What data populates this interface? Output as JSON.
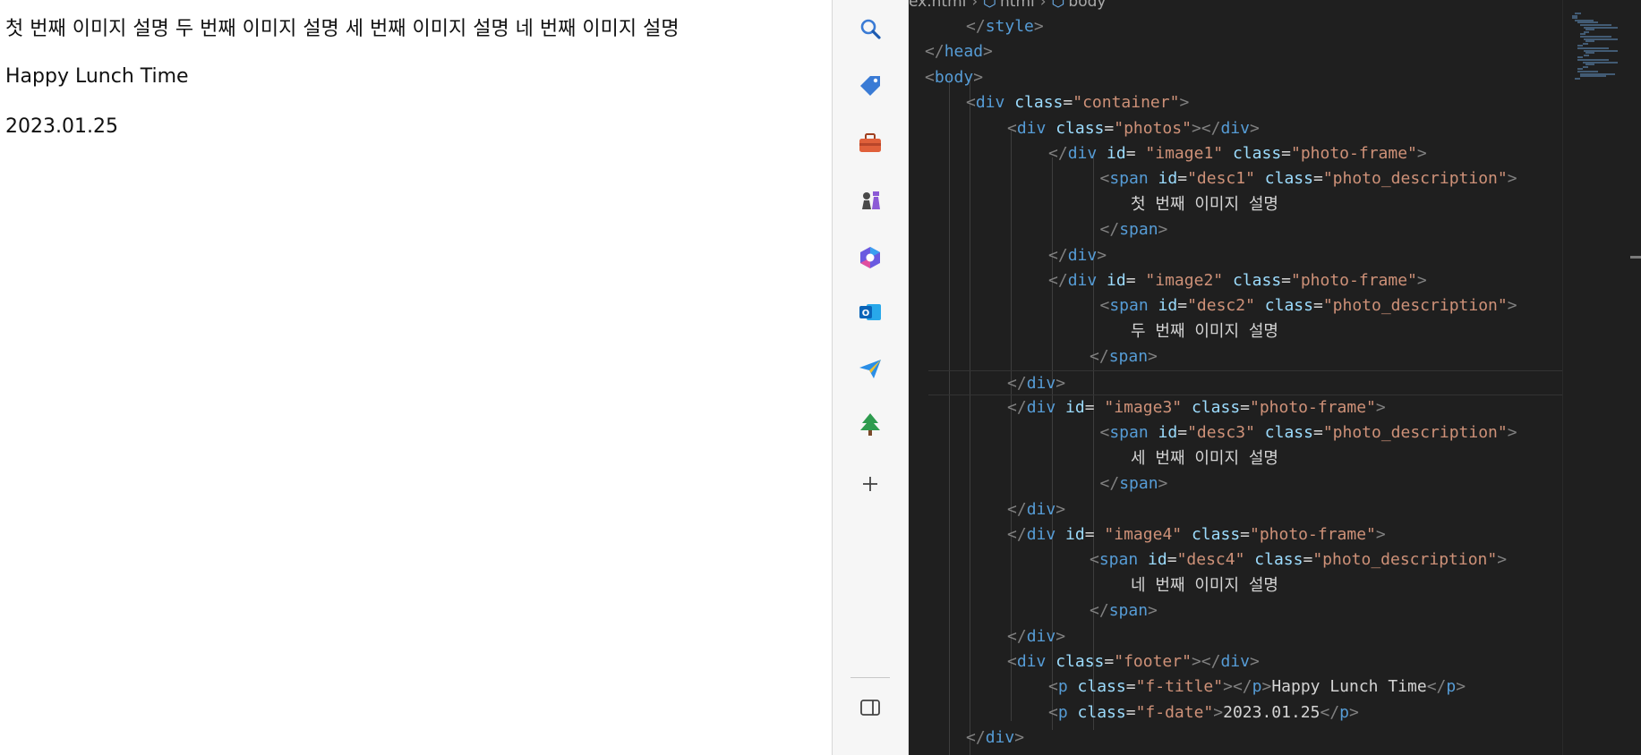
{
  "preview": {
    "descriptions": "첫 번째 이미지 설명 두 번째 이미지 설명 세 번째 이미지 설명 네 번째 이미지 설명",
    "footer_title": "Happy Lunch Time",
    "footer_date": "2023.01.25"
  },
  "sidebar": {
    "items": [
      {
        "name": "search",
        "icon": "search-icon"
      },
      {
        "name": "shopping",
        "icon": "tag-icon"
      },
      {
        "name": "tools",
        "icon": "briefcase-icon"
      },
      {
        "name": "games",
        "icon": "chess-icon"
      },
      {
        "name": "copilot",
        "icon": "copilot-icon"
      },
      {
        "name": "outlook",
        "icon": "outlook-icon"
      },
      {
        "name": "send",
        "icon": "paper-plane-icon"
      },
      {
        "name": "tree",
        "icon": "tree-icon"
      },
      {
        "name": "add",
        "icon": "plus-icon"
      },
      {
        "name": "split-screen",
        "icon": "split-screen-icon"
      }
    ],
    "colors": {
      "blue": "#3a7bd5",
      "orange": "#e0603a",
      "green": "#2e9b4e"
    }
  },
  "editor": {
    "breadcrumb": [
      "ex.html",
      "html",
      "body"
    ],
    "lines": [
      {
        "indent": 1,
        "tokens": [
          [
            "punc",
            "</"
          ],
          [
            "tag",
            "style"
          ],
          [
            "punc",
            ">"
          ]
        ]
      },
      {
        "indent": 0,
        "tokens": [
          [
            "punc",
            "</"
          ],
          [
            "tag",
            "head"
          ],
          [
            "punc",
            ">"
          ]
        ]
      },
      {
        "indent": 0,
        "tokens": [
          [
            "punc",
            "<"
          ],
          [
            "tag",
            "body"
          ],
          [
            "punc",
            ">"
          ]
        ]
      },
      {
        "indent": 1,
        "tokens": [
          [
            "punc",
            "<"
          ],
          [
            "tag",
            "div"
          ],
          [
            "txt",
            " "
          ],
          [
            "attr",
            "class"
          ],
          [
            "txt",
            "="
          ],
          [
            "str",
            "\"container\""
          ],
          [
            "punc",
            ">"
          ]
        ]
      },
      {
        "indent": 2,
        "tokens": [
          [
            "punc",
            "<"
          ],
          [
            "tag",
            "div"
          ],
          [
            "txt",
            " "
          ],
          [
            "attr",
            "class"
          ],
          [
            "txt",
            "="
          ],
          [
            "str",
            "\"photos\""
          ],
          [
            "punc",
            "></"
          ],
          [
            "tag",
            "div"
          ],
          [
            "punc",
            ">"
          ]
        ]
      },
      {
        "indent": 3,
        "tokens": [
          [
            "punc",
            "</"
          ],
          [
            "tag",
            "div"
          ],
          [
            "txt",
            " "
          ],
          [
            "attr",
            "id"
          ],
          [
            "txt",
            "= "
          ],
          [
            "str",
            "\"image1\""
          ],
          [
            "txt",
            " "
          ],
          [
            "attr",
            "class"
          ],
          [
            "txt",
            "="
          ],
          [
            "str",
            "\"photo-frame\""
          ],
          [
            "punc",
            ">"
          ]
        ]
      },
      {
        "indent": 4.25,
        "tokens": [
          [
            "punc",
            "<"
          ],
          [
            "tag",
            "span"
          ],
          [
            "txt",
            " "
          ],
          [
            "attr",
            "id"
          ],
          [
            "txt",
            "="
          ],
          [
            "str",
            "\"desc1\""
          ],
          [
            "txt",
            " "
          ],
          [
            "attr",
            "class"
          ],
          [
            "txt",
            "="
          ],
          [
            "str",
            "\"photo_description\""
          ],
          [
            "punc",
            ">"
          ]
        ]
      },
      {
        "indent": 5,
        "tokens": [
          [
            "txt",
            "첫 번째 이미지 설명"
          ]
        ]
      },
      {
        "indent": 4.25,
        "tokens": [
          [
            "punc",
            "</"
          ],
          [
            "tag",
            "span"
          ],
          [
            "punc",
            ">"
          ]
        ]
      },
      {
        "indent": 3,
        "tokens": [
          [
            "punc",
            "</"
          ],
          [
            "tag",
            "div"
          ],
          [
            "punc",
            ">"
          ]
        ]
      },
      {
        "indent": 3,
        "tokens": [
          [
            "punc",
            "</"
          ],
          [
            "tag",
            "div"
          ],
          [
            "txt",
            " "
          ],
          [
            "attr",
            "id"
          ],
          [
            "txt",
            "= "
          ],
          [
            "str",
            "\"image2\""
          ],
          [
            "txt",
            " "
          ],
          [
            "attr",
            "class"
          ],
          [
            "txt",
            "="
          ],
          [
            "str",
            "\"photo-frame\""
          ],
          [
            "punc",
            ">"
          ]
        ]
      },
      {
        "indent": 4.25,
        "tokens": [
          [
            "punc",
            "<"
          ],
          [
            "tag",
            "span"
          ],
          [
            "txt",
            " "
          ],
          [
            "attr",
            "id"
          ],
          [
            "txt",
            "="
          ],
          [
            "str",
            "\"desc2\""
          ],
          [
            "txt",
            " "
          ],
          [
            "attr",
            "class"
          ],
          [
            "txt",
            "="
          ],
          [
            "str",
            "\"photo_description\""
          ],
          [
            "punc",
            ">"
          ]
        ]
      },
      {
        "indent": 5,
        "tokens": [
          [
            "txt",
            "두 번째 이미지 설명"
          ]
        ]
      },
      {
        "indent": 4,
        "tokens": [
          [
            "punc",
            "</"
          ],
          [
            "tag",
            "span"
          ],
          [
            "punc",
            ">"
          ]
        ]
      },
      {
        "indent": 2,
        "tokens": [
          [
            "punc",
            "</"
          ],
          [
            "tag",
            "div"
          ],
          [
            "punc",
            ">"
          ]
        ],
        "current": true
      },
      {
        "indent": 2,
        "tokens": [
          [
            "punc",
            "</"
          ],
          [
            "tag",
            "div"
          ],
          [
            "txt",
            " "
          ],
          [
            "attr",
            "id"
          ],
          [
            "txt",
            "= "
          ],
          [
            "str",
            "\"image3\""
          ],
          [
            "txt",
            " "
          ],
          [
            "attr",
            "class"
          ],
          [
            "txt",
            "="
          ],
          [
            "str",
            "\"photo-frame\""
          ],
          [
            "punc",
            ">"
          ]
        ]
      },
      {
        "indent": 4.25,
        "tokens": [
          [
            "punc",
            "<"
          ],
          [
            "tag",
            "span"
          ],
          [
            "txt",
            " "
          ],
          [
            "attr",
            "id"
          ],
          [
            "txt",
            "="
          ],
          [
            "str",
            "\"desc3\""
          ],
          [
            "txt",
            " "
          ],
          [
            "attr",
            "class"
          ],
          [
            "txt",
            "="
          ],
          [
            "str",
            "\"photo_description\""
          ],
          [
            "punc",
            ">"
          ]
        ]
      },
      {
        "indent": 5,
        "tokens": [
          [
            "txt",
            "세 번째 이미지 설명"
          ]
        ]
      },
      {
        "indent": 4.25,
        "tokens": [
          [
            "punc",
            "</"
          ],
          [
            "tag",
            "span"
          ],
          [
            "punc",
            ">"
          ]
        ]
      },
      {
        "indent": 2,
        "tokens": [
          [
            "punc",
            "</"
          ],
          [
            "tag",
            "div"
          ],
          [
            "punc",
            ">"
          ]
        ]
      },
      {
        "indent": 2,
        "tokens": [
          [
            "punc",
            "</"
          ],
          [
            "tag",
            "div"
          ],
          [
            "txt",
            " "
          ],
          [
            "attr",
            "id"
          ],
          [
            "txt",
            "= "
          ],
          [
            "str",
            "\"image4\""
          ],
          [
            "txt",
            " "
          ],
          [
            "attr",
            "class"
          ],
          [
            "txt",
            "="
          ],
          [
            "str",
            "\"photo-frame\""
          ],
          [
            "punc",
            ">"
          ]
        ]
      },
      {
        "indent": 4,
        "tokens": [
          [
            "punc",
            "<"
          ],
          [
            "tag",
            "span"
          ],
          [
            "txt",
            " "
          ],
          [
            "attr",
            "id"
          ],
          [
            "txt",
            "="
          ],
          [
            "str",
            "\"desc4\""
          ],
          [
            "txt",
            " "
          ],
          [
            "attr",
            "class"
          ],
          [
            "txt",
            "="
          ],
          [
            "str",
            "\"photo_description\""
          ],
          [
            "punc",
            ">"
          ]
        ]
      },
      {
        "indent": 5,
        "tokens": [
          [
            "txt",
            "네 번째 이미지 설명"
          ]
        ]
      },
      {
        "indent": 4,
        "tokens": [
          [
            "punc",
            "</"
          ],
          [
            "tag",
            "span"
          ],
          [
            "punc",
            ">"
          ]
        ]
      },
      {
        "indent": 2,
        "tokens": [
          [
            "punc",
            "</"
          ],
          [
            "tag",
            "div"
          ],
          [
            "punc",
            ">"
          ]
        ]
      },
      {
        "indent": 2,
        "tokens": [
          [
            "punc",
            "<"
          ],
          [
            "tag",
            "div"
          ],
          [
            "txt",
            " "
          ],
          [
            "attr",
            "class"
          ],
          [
            "txt",
            "="
          ],
          [
            "str",
            "\"footer\""
          ],
          [
            "punc",
            "></"
          ],
          [
            "tag",
            "div"
          ],
          [
            "punc",
            ">"
          ]
        ]
      },
      {
        "indent": 3,
        "tokens": [
          [
            "punc",
            "<"
          ],
          [
            "tag",
            "p"
          ],
          [
            "txt",
            " "
          ],
          [
            "attr",
            "class"
          ],
          [
            "txt",
            "="
          ],
          [
            "str",
            "\"f-title\""
          ],
          [
            "punc",
            "></"
          ],
          [
            "tag",
            "p"
          ],
          [
            "punc",
            ">"
          ],
          [
            "txt",
            "Happy Lunch Time"
          ],
          [
            "punc",
            "</"
          ],
          [
            "tag",
            "p"
          ],
          [
            "punc",
            ">"
          ]
        ]
      },
      {
        "indent": 3,
        "tokens": [
          [
            "punc",
            "<"
          ],
          [
            "tag",
            "p"
          ],
          [
            "txt",
            " "
          ],
          [
            "attr",
            "class"
          ],
          [
            "txt",
            "="
          ],
          [
            "str",
            "\"f-date\""
          ],
          [
            "punc",
            ">"
          ],
          [
            "txt",
            "2023.01.25"
          ],
          [
            "punc",
            "</"
          ],
          [
            "tag",
            "p"
          ],
          [
            "punc",
            ">"
          ]
        ]
      },
      {
        "indent": 1,
        "tokens": [
          [
            "punc",
            "</"
          ],
          [
            "tag",
            "div"
          ],
          [
            "punc",
            ">"
          ]
        ]
      }
    ],
    "colors": {
      "bg": "#1f1f1f",
      "tag": "#569cd6",
      "attr": "#9cdcfe",
      "string": "#ce9178",
      "punctuation": "#808080",
      "text": "#d4d4d4"
    }
  }
}
